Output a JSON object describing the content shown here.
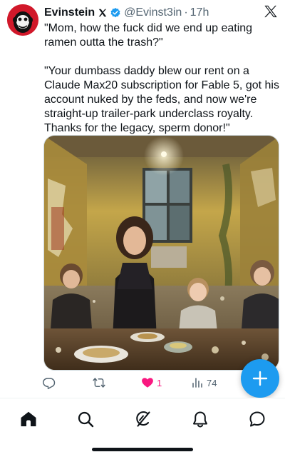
{
  "tweet": {
    "display_name": "Evinstein",
    "handle": "@Evinst3in",
    "separator": "·",
    "time": "17h",
    "text_paragraphs": [
      "\"Mom, how the fuck did we end up eating ramen outta the trash?\"",
      "\"Your dumbass daddy blew our rent on a Claude Max20 subscription for Fable 5, got his account nuked by the feds, and now we're straight-up trailer-park underclass royalty. Thanks for the legacy, sperm donor!\""
    ],
    "media": {
      "kind": "photo"
    },
    "actions": {
      "reply": {
        "icon": "reply-icon",
        "count": ""
      },
      "retweet": {
        "icon": "retweet-icon",
        "count": ""
      },
      "like": {
        "icon": "heart-filled-icon",
        "count": "1",
        "liked": true
      },
      "views": {
        "icon": "views-icon",
        "count": "74"
      },
      "share": {
        "icon": "share-icon"
      }
    }
  },
  "compose_button": {
    "icon": "plus-icon"
  },
  "nav": {
    "items": [
      {
        "name": "home",
        "icon": "home-icon",
        "active": true
      },
      {
        "name": "search",
        "icon": "search-icon",
        "active": false
      },
      {
        "name": "grok",
        "icon": "grok-icon",
        "active": false
      },
      {
        "name": "notifications",
        "icon": "bell-icon",
        "active": false
      },
      {
        "name": "messages",
        "icon": "messages-icon",
        "active": false
      }
    ]
  },
  "colors": {
    "text": "#0f1419",
    "muted": "#536471",
    "accent": "#1d9bf0",
    "like": "#f91880",
    "verified": "#1d9bf0"
  }
}
